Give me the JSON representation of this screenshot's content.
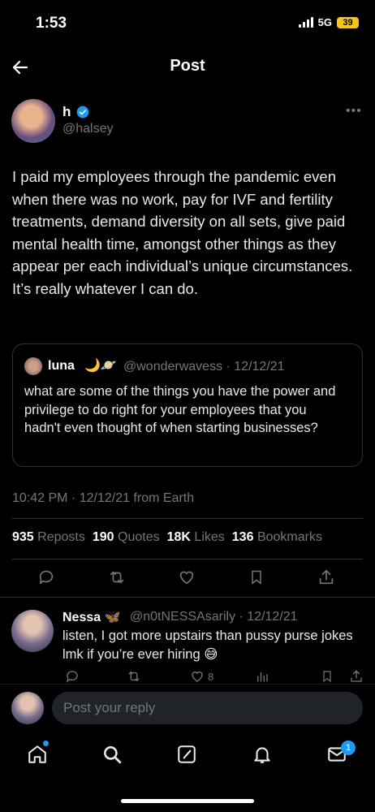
{
  "status_bar": {
    "time": "1:53",
    "network": "5G",
    "battery": "39"
  },
  "header": {
    "title": "Post"
  },
  "tweet": {
    "author_name": "h",
    "author_handle": "@halsey",
    "text": "I paid my employees through the pandemic even when there was no work, pay for IVF and fertility treatments, demand diversity on all sets, give paid mental health time, amongst other things as they appear per each individual’s unique circumstances. It’s really whatever I can do.",
    "timestamp": "10:42 PM · 12/12/21 from Earth",
    "stats": {
      "reposts": "935",
      "reposts_label": "Reposts",
      "quotes": "190",
      "quotes_label": "Quotes",
      "likes": "18K",
      "likes_label": "Likes",
      "bookmarks": "136",
      "bookmarks_label": "Bookmarks"
    }
  },
  "quote": {
    "name": "luna",
    "emoji": "🌙🪐",
    "handle_date": "@wonderwavess · 12/12/21",
    "text": "what are some of the things you have the power and privilege to do right for your employees that you hadn't even thought of when starting businesses?"
  },
  "reply": {
    "name": "Nessa",
    "emoji": "🦋",
    "handle_date": "@n0tNESSAsarily · 12/12/21",
    "text": "listen, I got more upstairs than pussy purse jokes lmk if you’re ever hiring 😅",
    "like_count": "8"
  },
  "compose": {
    "placeholder": "Post your reply"
  },
  "nav": {
    "messages_badge": "1"
  },
  "colors": {
    "accent": "#1d9bf0",
    "background": "#000000",
    "muted": "#71767b"
  },
  "icons": [
    "back-arrow-icon",
    "verified-icon",
    "more-icon",
    "reply-icon",
    "repost-icon",
    "like-icon",
    "bookmark-icon",
    "share-icon",
    "analytics-icon",
    "home-icon",
    "search-icon",
    "grok-icon",
    "bell-icon",
    "mail-icon"
  ]
}
